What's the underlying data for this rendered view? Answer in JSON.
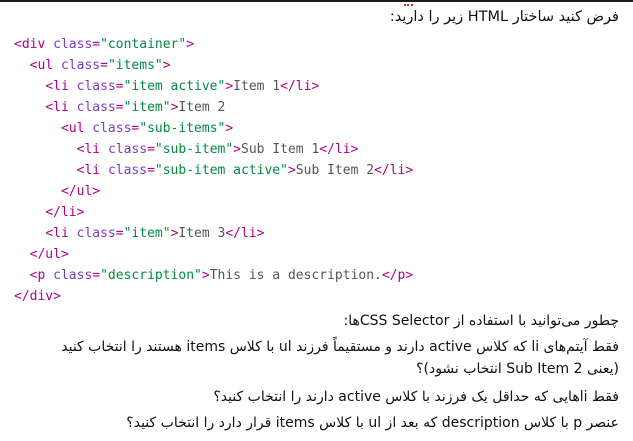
{
  "intro": "فرض کنید ساختار HTML زیر را دارید:",
  "code": [
    [
      {
        "t": "tag",
        "v": "<div "
      },
      {
        "t": "attr",
        "v": "class"
      },
      {
        "t": "tag",
        "v": "="
      },
      {
        "t": "str",
        "v": "\"container\""
      },
      {
        "t": "tag",
        "v": ">"
      }
    ],
    [
      {
        "t": "sp",
        "v": "  "
      },
      {
        "t": "tag",
        "v": "<ul "
      },
      {
        "t": "attr",
        "v": "class"
      },
      {
        "t": "tag",
        "v": "="
      },
      {
        "t": "str",
        "v": "\"items\""
      },
      {
        "t": "tag",
        "v": ">"
      }
    ],
    [
      {
        "t": "sp",
        "v": "    "
      },
      {
        "t": "tag",
        "v": "<li "
      },
      {
        "t": "attr",
        "v": "class"
      },
      {
        "t": "tag",
        "v": "="
      },
      {
        "t": "str",
        "v": "\"item active\""
      },
      {
        "t": "tag",
        "v": ">"
      },
      {
        "t": "txt",
        "v": "Item 1"
      },
      {
        "t": "tag",
        "v": "</li>"
      }
    ],
    [
      {
        "t": "sp",
        "v": "    "
      },
      {
        "t": "tag",
        "v": "<li "
      },
      {
        "t": "attr",
        "v": "class"
      },
      {
        "t": "tag",
        "v": "="
      },
      {
        "t": "str",
        "v": "\"item\""
      },
      {
        "t": "tag",
        "v": ">"
      },
      {
        "t": "txt",
        "v": "Item 2"
      }
    ],
    [
      {
        "t": "sp",
        "v": "      "
      },
      {
        "t": "tag",
        "v": "<ul "
      },
      {
        "t": "attr",
        "v": "class"
      },
      {
        "t": "tag",
        "v": "="
      },
      {
        "t": "str",
        "v": "\"sub-items\""
      },
      {
        "t": "tag",
        "v": ">"
      }
    ],
    [
      {
        "t": "sp",
        "v": "        "
      },
      {
        "t": "tag",
        "v": "<li "
      },
      {
        "t": "attr",
        "v": "class"
      },
      {
        "t": "tag",
        "v": "="
      },
      {
        "t": "str",
        "v": "\"sub-item\""
      },
      {
        "t": "tag",
        "v": ">"
      },
      {
        "t": "txt",
        "v": "Sub Item 1"
      },
      {
        "t": "tag",
        "v": "</li>"
      }
    ],
    [
      {
        "t": "sp",
        "v": "        "
      },
      {
        "t": "tag",
        "v": "<li "
      },
      {
        "t": "attr",
        "v": "class"
      },
      {
        "t": "tag",
        "v": "="
      },
      {
        "t": "str",
        "v": "\"sub-item active\""
      },
      {
        "t": "tag",
        "v": ">"
      },
      {
        "t": "txt",
        "v": "Sub Item 2"
      },
      {
        "t": "tag",
        "v": "</li>"
      }
    ],
    [
      {
        "t": "sp",
        "v": "      "
      },
      {
        "t": "tag",
        "v": "</ul>"
      }
    ],
    [
      {
        "t": "sp",
        "v": "    "
      },
      {
        "t": "tag",
        "v": "</li>"
      }
    ],
    [
      {
        "t": "sp",
        "v": "    "
      },
      {
        "t": "tag",
        "v": "<li "
      },
      {
        "t": "attr",
        "v": "class"
      },
      {
        "t": "tag",
        "v": "="
      },
      {
        "t": "str",
        "v": "\"item\""
      },
      {
        "t": "tag",
        "v": ">"
      },
      {
        "t": "txt",
        "v": "Item 3"
      },
      {
        "t": "tag",
        "v": "</li>"
      }
    ],
    [
      {
        "t": "sp",
        "v": "  "
      },
      {
        "t": "tag",
        "v": "</ul>"
      }
    ],
    [
      {
        "t": "sp",
        "v": "  "
      },
      {
        "t": "tag",
        "v": "<p "
      },
      {
        "t": "attr",
        "v": "class"
      },
      {
        "t": "tag",
        "v": "="
      },
      {
        "t": "str",
        "v": "\"description\""
      },
      {
        "t": "tag",
        "v": ">"
      },
      {
        "t": "txt",
        "v": "This is a description."
      },
      {
        "t": "tag",
        "v": "</p>"
      }
    ],
    [
      {
        "t": "tag",
        "v": "</div>"
      }
    ]
  ],
  "questions": {
    "heading": "چطور می‌توانید با استفاده از CSS Selectorها:",
    "q1_line1": "فقط آیتم‌های li که کلاس active دارند و مستقیماً فرزند ul با کلاس items هستند را انتخاب کنید",
    "q1_line2": "(یعنی Sub Item 2 انتخاب نشود)؟",
    "q2": "فقط liهایی که حداقل یک فرزند با کلاس active دارند را انتخاب کنید؟",
    "q3": "عنصر p با کلاس description که بعد از ul با کلاس items قرار دارد را انتخاب کنید؟"
  },
  "colors": {
    "tag": "#b1008a",
    "attr": "#7a3cc4",
    "string": "#008a3e",
    "text": "#555555",
    "squiggle": "#d02a2a"
  }
}
